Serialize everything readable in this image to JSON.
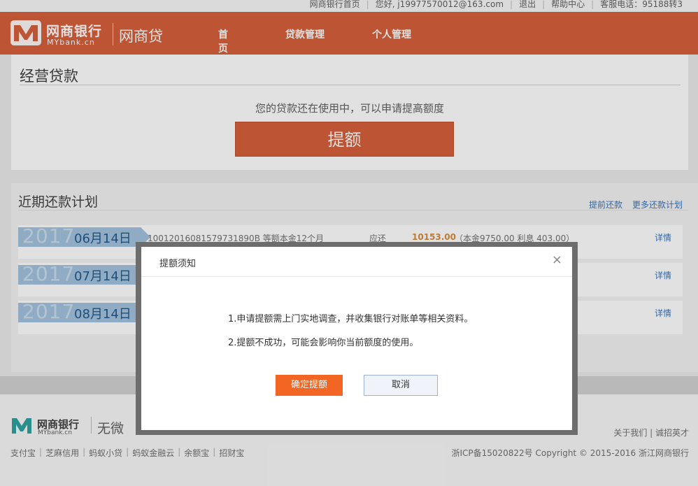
{
  "topbar": {
    "links": [
      "网商银行首页",
      "您好, j19977570012@163.com",
      "退出",
      "帮助中心",
      "客服电话：95188转3"
    ]
  },
  "header": {
    "logo_cn": "网商银行",
    "logo_en": "MYbank.cn",
    "product": "网商贷",
    "nav": [
      "首页",
      "贷款管理",
      "个人管理"
    ],
    "brand_color": "#d4532b"
  },
  "loan": {
    "title": "经营贷款",
    "message": "您的贷款还在使用中，可以申请提高额度",
    "raise_button": "提额"
  },
  "plan": {
    "title": "近期还款计划",
    "links": [
      "提前还款",
      "更多还款计划"
    ],
    "rows": [
      {
        "year": "2017",
        "date": "06月14日",
        "id": "10012016081579731890B 等额本金12个月",
        "due_label": "应还",
        "amount": "10153.00",
        "detail": "（本金9750.00  利息 403.00）",
        "link": "详情"
      },
      {
        "year": "2017",
        "date": "07月14日",
        "link": "详情"
      },
      {
        "year": "2017",
        "date": "08月14日",
        "link": "详情"
      }
    ]
  },
  "footer": {
    "logo_cn": "网商银行",
    "logo_en": "MYbank.cn",
    "slogan": "无微",
    "right_links": "关于我们 | 诚招英才",
    "bottom_links": [
      "支付宝",
      "芝麻信用",
      "蚂蚁小贷",
      "蚂蚁金融云",
      "余额宝",
      "招财宝"
    ],
    "icp": "浙ICP备15020822号 Copyright © 2015-2016 浙江网商银行"
  },
  "modal": {
    "title": "提额须知",
    "close": "×",
    "line1": "1.申请提额需上门实地调查，并收集银行对账单等相关资料。",
    "line2": "2.提额不成功，可能会影响你当前额度的使用。",
    "confirm": "确定提额",
    "cancel": "取消",
    "confirm_color": "#f26522"
  }
}
